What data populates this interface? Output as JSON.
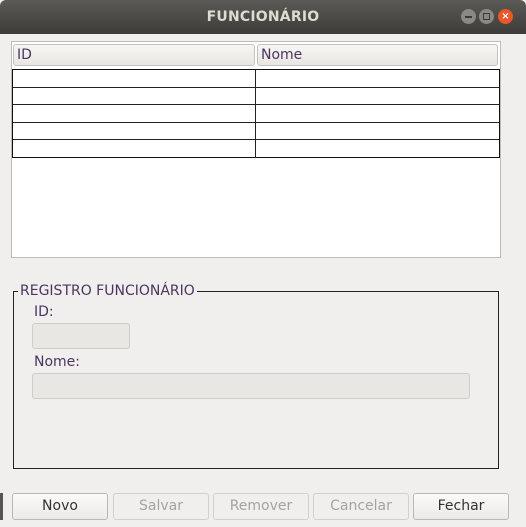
{
  "window": {
    "title": "FUNCIONÁRIO"
  },
  "table": {
    "columns": [
      "ID",
      "Nome"
    ],
    "rows": [
      [
        "",
        ""
      ],
      [
        "",
        ""
      ],
      [
        "",
        ""
      ],
      [
        "",
        ""
      ],
      [
        "",
        ""
      ]
    ]
  },
  "form": {
    "legend": "REGISTRO FUNCIONÁRIO",
    "id_label": "ID:",
    "id_value": "",
    "nome_label": "Nome:",
    "nome_value": ""
  },
  "buttons": {
    "novo": "Novo",
    "salvar": "Salvar",
    "remover": "Remover",
    "cancelar": "Cancelar",
    "fechar": "Fechar"
  },
  "colors": {
    "titlebar": "#3d3c39",
    "label_text": "#4a3560",
    "close_button": "#e9572a"
  },
  "icons": [
    "minimize-icon",
    "maximize-icon",
    "close-icon"
  ]
}
